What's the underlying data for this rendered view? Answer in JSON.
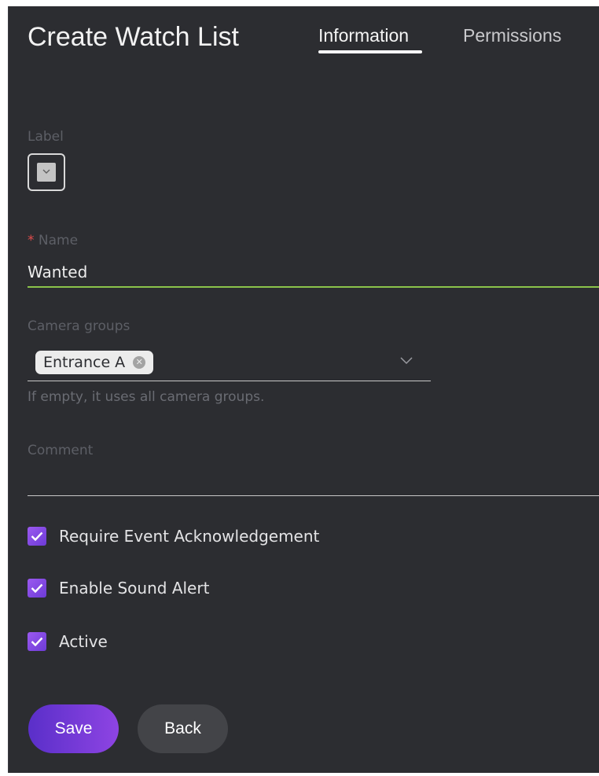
{
  "header": {
    "title": "Create Watch List",
    "tabs": [
      {
        "label": "Information",
        "active": true
      },
      {
        "label": "Permissions",
        "active": false
      }
    ]
  },
  "form": {
    "label_field": {
      "label": "Label"
    },
    "name_field": {
      "required_mark": "*",
      "label": "Name",
      "value": "Wanted"
    },
    "camera_groups": {
      "label": "Camera groups",
      "chips": [
        "Entrance A"
      ],
      "help": "If empty, it uses all camera groups."
    },
    "comment_field": {
      "label": "Comment",
      "value": ""
    },
    "checkboxes": [
      {
        "label": "Require Event Acknowledgement",
        "checked": true
      },
      {
        "label": "Enable Sound Alert",
        "checked": true
      },
      {
        "label": "Active",
        "checked": true
      }
    ]
  },
  "actions": {
    "save_label": "Save",
    "back_label": "Back"
  },
  "colors": {
    "panel_bg": "#2c2d31",
    "accent_purple": "#8e44e3",
    "valid_underline": "#8bc34a",
    "required": "#e04c4c"
  },
  "icons": {
    "label_picker": "chevron-down-icon",
    "chip_remove": "close-circle-icon",
    "groups_dropdown": "chevron-down-icon",
    "checkbox": "check-icon"
  }
}
